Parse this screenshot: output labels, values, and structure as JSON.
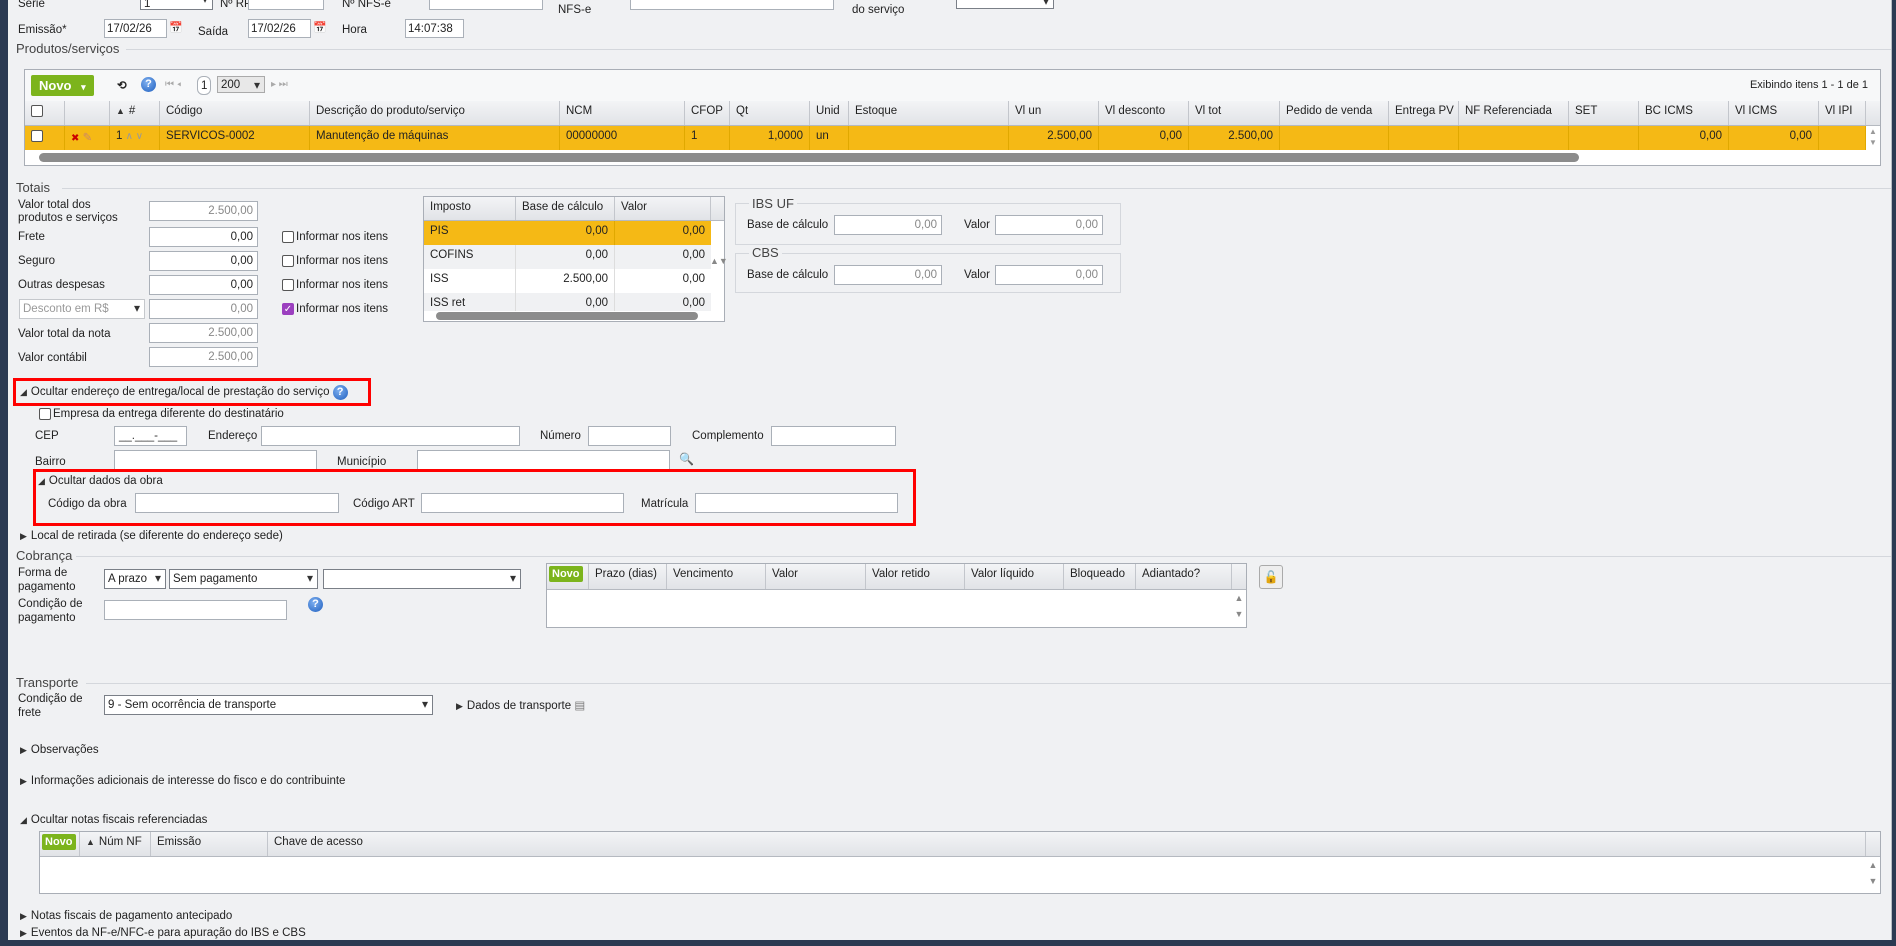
{
  "header": {
    "serie_label": "Série",
    "serie_value": "1",
    "rps_label": "Nº RPS",
    "rps_value": "",
    "nfse_label": "Nº NFS-e",
    "nfse_value": "",
    "nfse2_label": "NFS-e",
    "servico_label": "do serviço",
    "emissao_label": "Emissão*",
    "emissao_value": "17/02/26",
    "saida_label": "Saída",
    "saida_value": "17/02/26",
    "hora_label": "Hora",
    "hora_value": "14:07:38"
  },
  "produtos": {
    "legend": "Produtos/serviços",
    "novo_label": "Novo",
    "page": "1",
    "page_size": "200",
    "showing": "Exibindo itens 1 - 1 de 1",
    "columns": [
      "",
      "",
      "#",
      "Código",
      "Descrição do produto/serviço",
      "NCM",
      "CFOP",
      "Qt",
      "Unid",
      "Estoque",
      "Vl un",
      "Vl desconto",
      "Vl tot",
      "Pedido de venda",
      "Entrega PV",
      "NF Referenciada",
      "SET",
      "BC ICMS",
      "Vl ICMS",
      "Vl IPI"
    ],
    "rows": [
      {
        "num": "1",
        "codigo": "SERVICOS-0002",
        "descricao": "Manutenção de máquinas",
        "ncm": "00000000",
        "cfop": "1",
        "qt": "1,0000",
        "unid": "un",
        "estoque": "",
        "vl_un": "2.500,00",
        "vl_desconto": "0,00",
        "vl_tot": "2.500,00",
        "pedido": "",
        "entrega": "",
        "nf_ref": "",
        "set": "",
        "bc_icms": "0,00",
        "vl_icms": "0,00",
        "vl_ipi": ""
      }
    ]
  },
  "totais": {
    "legend": "Totais",
    "valor_total_produtos_label": "Valor total dos produtos e serviços",
    "valor_total_produtos": "2.500,00",
    "frete_label": "Frete",
    "frete": "0,00",
    "seguro_label": "Seguro",
    "seguro": "0,00",
    "outras_label": "Outras despesas",
    "outras": "0,00",
    "desconto_select": "Desconto em R$",
    "desconto": "0,00",
    "valor_total_nota_label": "Valor total da nota",
    "valor_total_nota": "2.500,00",
    "valor_contabil_label": "Valor contábil",
    "valor_contabil": "2.500,00",
    "informar_label": "Informar nos itens",
    "impostos_columns": [
      "Imposto",
      "Base de cálculo",
      "Valor"
    ],
    "impostos": [
      {
        "nome": "PIS",
        "base": "0,00",
        "valor": "0,00"
      },
      {
        "nome": "COFINS",
        "base": "0,00",
        "valor": "0,00"
      },
      {
        "nome": "ISS",
        "base": "2.500,00",
        "valor": "0,00"
      },
      {
        "nome": "ISS ret",
        "base": "0,00",
        "valor": "0,00"
      }
    ],
    "ibs_legend": "IBS UF",
    "cbs_legend": "CBS",
    "base_label": "Base de cálculo",
    "valor_label": "Valor",
    "ibs_base": "0,00",
    "ibs_valor": "0,00",
    "cbs_base": "0,00",
    "cbs_valor": "0,00"
  },
  "endereco": {
    "toggle": "Ocultar endereço de entrega/local de prestação do serviço",
    "empresa_diferente": "Empresa da entrega diferente do destinatário",
    "cep_label": "CEP",
    "cep_placeholder": "__.___-___",
    "endereco_label": "Endereço",
    "numero_label": "Número",
    "complemento_label": "Complemento",
    "bairro_label": "Bairro",
    "municipio_label": "Município",
    "obra_toggle": "Ocultar dados da obra",
    "codigo_obra_label": "Código da obra",
    "codigo_art_label": "Código ART",
    "matricula_label": "Matrícula",
    "local_retirada": "Local de retirada (se diferente do endereço sede)"
  },
  "cobranca": {
    "legend": "Cobrança",
    "forma_label": "Forma de pagamento",
    "forma_value": "A prazo",
    "tipo_value": "Sem pagamento",
    "extra_value": "",
    "condicao_label": "Condição de pagamento",
    "columns": [
      "Novo",
      "Prazo (dias)",
      "Vencimento",
      "Valor",
      "Valor retido",
      "Valor líquido",
      "Bloqueado",
      "Adiantado?"
    ]
  },
  "transporte": {
    "legend": "Transporte",
    "frete_label": "Condição de frete",
    "frete_value": "9 - Sem ocorrência de transporte",
    "dados_label": "Dados de transporte"
  },
  "sections": {
    "observacoes": "Observações",
    "info_adicionais": "Informações adicionais de interesse do fisco e do contribuinte",
    "notas_ref": "Ocultar notas fiscais referenciadas",
    "notas_ref_columns": [
      "Novo",
      "Núm NF",
      "Emissão",
      "Chave de acesso"
    ],
    "notas_antecipado": "Notas fiscais de pagamento antecipado",
    "eventos": "Eventos da NF-e/NFC-e para apuração do IBS e CBS"
  },
  "colors": {
    "selected_row": "#f5b915",
    "novo": "#7cb41c",
    "highlight": "#ff0000"
  }
}
